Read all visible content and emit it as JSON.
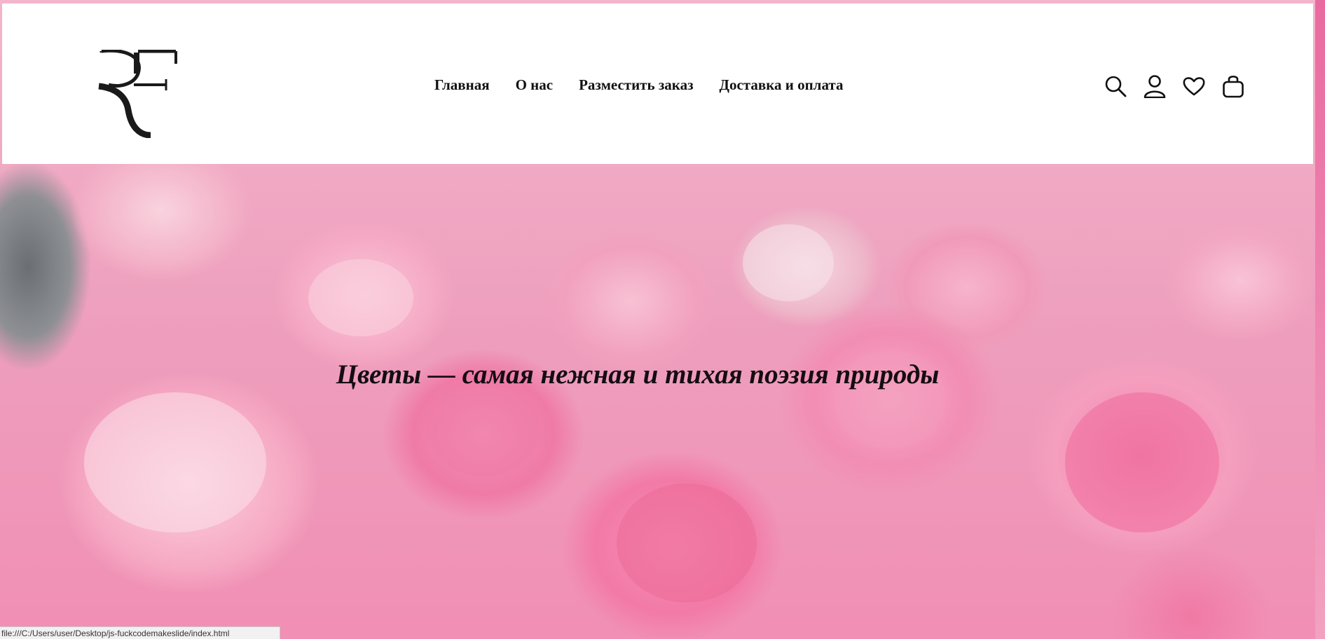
{
  "brand": {
    "logo_text": "RF"
  },
  "nav": {
    "items": [
      {
        "label": "Главная"
      },
      {
        "label": "О нас"
      },
      {
        "label": "Разместить заказ"
      },
      {
        "label": "Доставка и оплата"
      }
    ]
  },
  "header_icons": [
    "search-icon",
    "user-icon",
    "heart-icon",
    "bag-icon"
  ],
  "hero": {
    "tagline": "Цветы — самая нежная и тихая поэзия природы"
  },
  "status_bar": {
    "url": "file:///C:/Users/user/Desktop/js-fuckcodemakeslide/index.html"
  },
  "colors": {
    "header_bg": "#ffffff",
    "text": "#111111",
    "accent_pink": "#f27ea8"
  }
}
